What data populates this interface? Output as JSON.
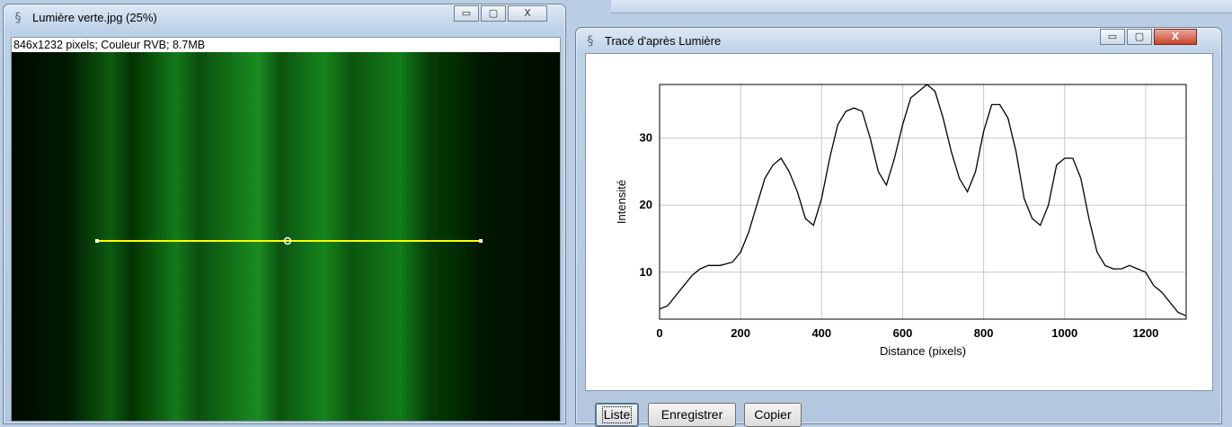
{
  "image_window": {
    "title": "Lumière verte.jpg (25%)",
    "info": "846x1232 pixels; Couleur RVB; 8.7MB",
    "controls": {
      "minimize": "▭",
      "maximize": "▢",
      "close": "X"
    },
    "icon": "imagej-icon"
  },
  "plot_window": {
    "title": "Tracé d'après Lumière",
    "controls": {
      "minimize": "▭",
      "maximize": "▢",
      "close": "X"
    },
    "icon": "imagej-icon",
    "buttons": {
      "list": "Liste",
      "save": "Enregistrer",
      "copy": "Copier"
    }
  },
  "colors": {
    "profile_line": "#ffff00",
    "plot_line": "#000000",
    "grid": "#c8c8c8"
  },
  "chart_data": {
    "type": "line",
    "title": "",
    "xlabel": "Distance (pixels)",
    "ylabel": "Intensité",
    "xlim": [
      0,
      1300
    ],
    "ylim": [
      3,
      38
    ],
    "xticks": [
      "0",
      "200",
      "400",
      "600",
      "800",
      "1000",
      "1200"
    ],
    "yticks": [
      "10",
      "20",
      "30"
    ],
    "grid": true,
    "series": [
      {
        "x": [
          0,
          20,
          40,
          60,
          80,
          100,
          120,
          150,
          180,
          200,
          220,
          240,
          260,
          280,
          300,
          320,
          340,
          360,
          380,
          400,
          420,
          440,
          460,
          480,
          500,
          520,
          540,
          560,
          580,
          600,
          620,
          640,
          660,
          680,
          700,
          720,
          740,
          760,
          780,
          800,
          820,
          840,
          860,
          880,
          900,
          920,
          940,
          960,
          980,
          1000,
          1020,
          1040,
          1060,
          1080,
          1100,
          1120,
          1140,
          1160,
          1180,
          1200,
          1220,
          1240,
          1260,
          1280,
          1300
        ],
        "y": [
          4.5,
          5,
          6.5,
          8,
          9.5,
          10.5,
          11,
          11,
          11.5,
          13,
          16,
          20,
          24,
          26,
          27,
          25,
          22,
          18,
          17,
          21,
          27,
          32,
          34,
          34.5,
          34,
          30,
          25,
          23,
          27,
          32,
          36,
          37,
          38,
          37,
          33,
          28,
          24,
          22,
          25,
          31,
          35,
          35,
          33,
          28,
          21,
          18,
          17,
          20,
          26,
          27,
          27,
          24,
          18,
          13,
          11,
          10.5,
          10.5,
          11,
          10.5,
          10,
          8,
          7,
          5.5,
          4,
          3.5
        ]
      }
    ]
  }
}
